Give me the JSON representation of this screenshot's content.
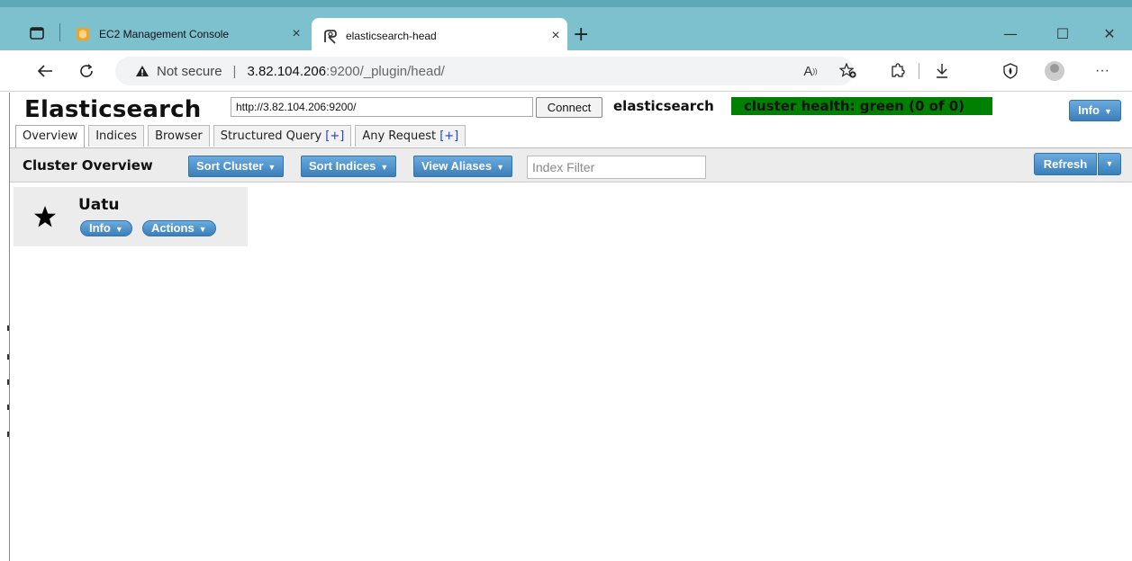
{
  "browser": {
    "tabs": [
      {
        "title": "EC2 Management Console",
        "active": false
      },
      {
        "title": "elasticsearch-head",
        "active": true
      }
    ],
    "address": {
      "security_label": "Not secure",
      "separator": "|",
      "host": "3.82.104.206",
      "path": ":9200/_plugin/head/"
    },
    "window_controls": {
      "minimize": "—",
      "maximize": "☐",
      "close": "✕"
    },
    "new_tab": "+",
    "more": "···"
  },
  "app": {
    "brand": "Elasticsearch",
    "connect_url": "http://3.82.104.206:9200/",
    "connect_label": "Connect",
    "cluster_name": "elasticsearch",
    "health_text": "cluster health: green (0 of 0)",
    "info_label": "Info",
    "tabs": [
      {
        "label": "Overview",
        "plus": ""
      },
      {
        "label": "Indices",
        "plus": ""
      },
      {
        "label": "Browser",
        "plus": ""
      },
      {
        "label": "Structured Query ",
        "plus": "[+]"
      },
      {
        "label": "Any Request ",
        "plus": "[+]"
      }
    ],
    "toolbar": {
      "title": "Cluster Overview",
      "sort_cluster": "Sort Cluster",
      "sort_indices": "Sort Indices",
      "view_aliases": "View Aliases",
      "filter_placeholder": "Index Filter",
      "refresh": "Refresh"
    },
    "node": {
      "name": "Uatu",
      "info_label": "Info",
      "actions_label": "Actions",
      "is_master": true
    }
  },
  "colors": {
    "tabbar": "#7dc1cf",
    "button_blue": "#3b7fba",
    "health_green": "#008000"
  }
}
